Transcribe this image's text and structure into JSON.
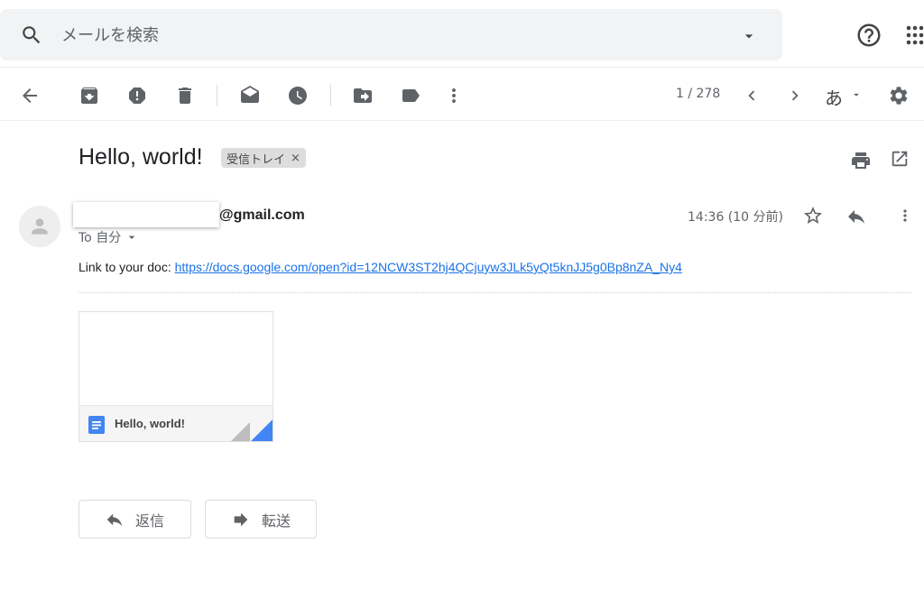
{
  "search": {
    "placeholder": "メールを検索"
  },
  "toolbar": {
    "pager": "1 / 278",
    "input_tool": "あ"
  },
  "message": {
    "subject": "Hello, world!",
    "label": "受信トレイ",
    "label_remove": "×",
    "sender_email": "@gmail.com",
    "recipient": "To 自分",
    "timestamp": "14:36 (10 分前)",
    "body_prefix": "Link to your doc: ",
    "body_link": "https://docs.google.com/open?id=12NCW3ST2hj4QCjuyw3JLk5yQt5knJJ5g0Bp8nZA_Ny4"
  },
  "attachment": {
    "name": "Hello, world!"
  },
  "actions": {
    "reply": "返信",
    "forward": "転送"
  },
  "icons": {
    "search": "search-icon",
    "help": "help-icon",
    "apps": "apps-icon",
    "back": "back-arrow-icon",
    "archive": "archive-icon",
    "spam": "report-spam-icon",
    "delete": "delete-icon",
    "mark_unread": "mark-unread-icon",
    "snooze": "snooze-icon",
    "move": "move-to-icon",
    "label": "label-icon",
    "more": "more-vert-icon",
    "settings": "gear-icon",
    "print": "print-icon",
    "open_new": "open-new-window-icon",
    "star": "star-icon",
    "reply": "reply-icon",
    "forward": "forward-icon",
    "doc": "google-doc-icon"
  },
  "colors": {
    "link": "#1a73e8",
    "doc_blue": "#4285f4",
    "search_bg": "#f1f3f4",
    "icon": "#5f6368"
  }
}
